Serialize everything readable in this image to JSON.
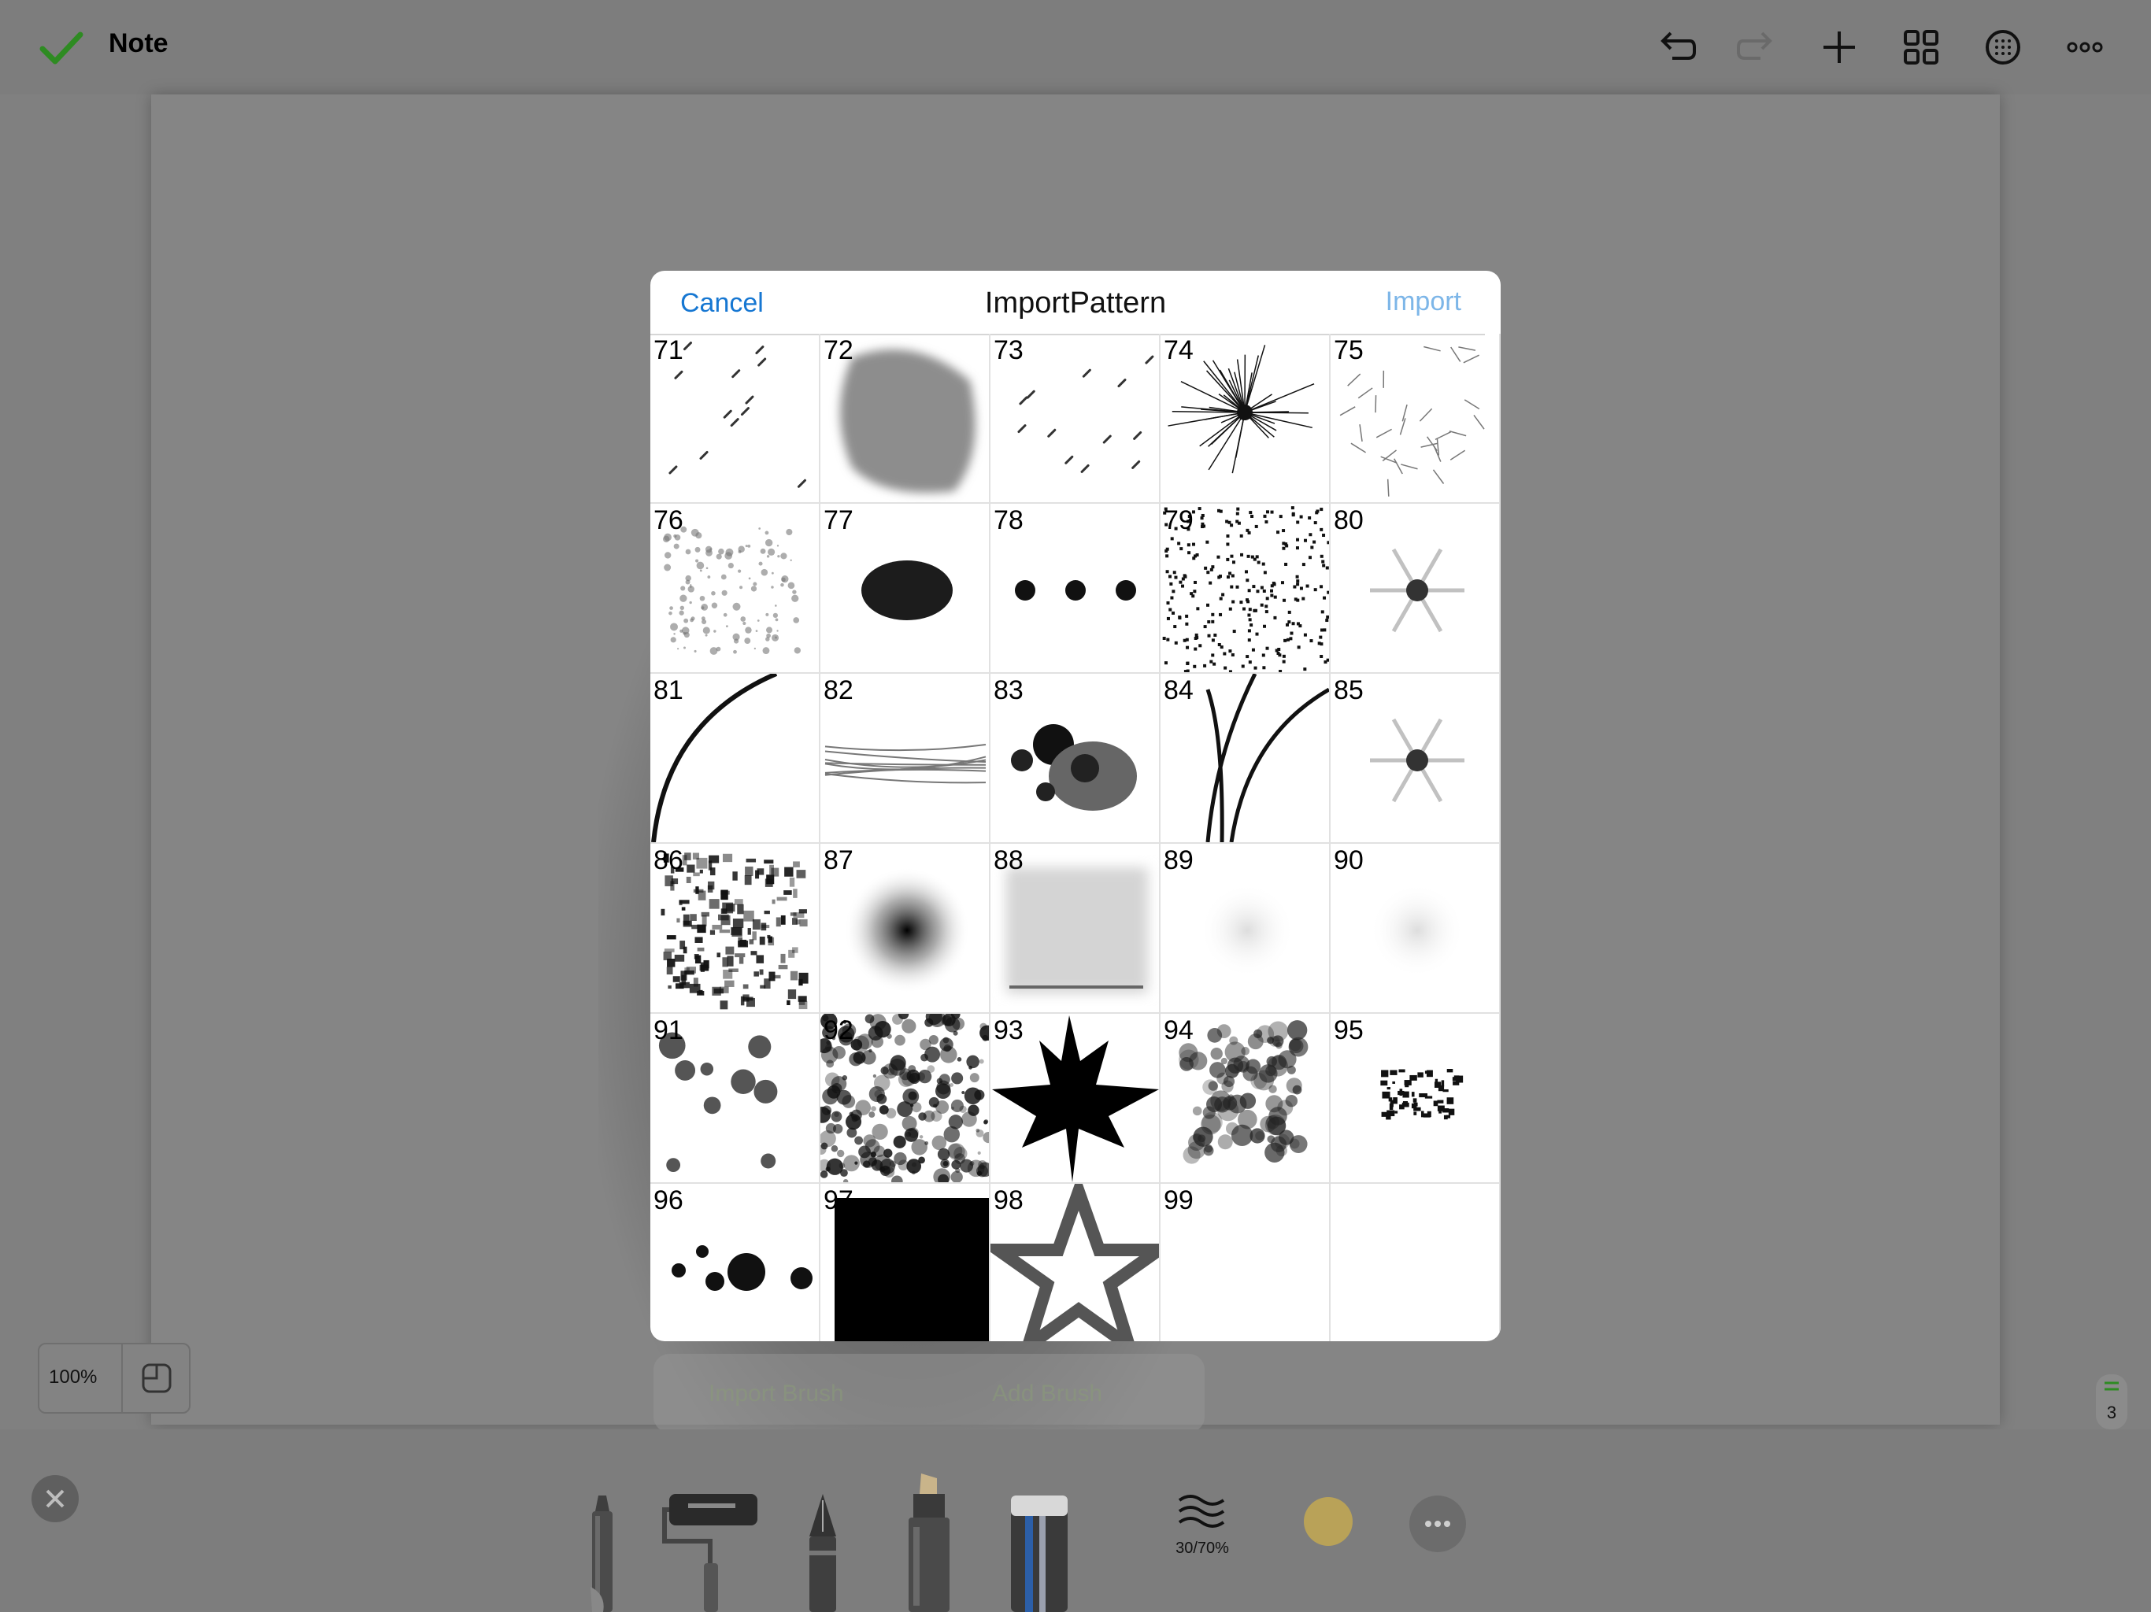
{
  "topbar": {
    "title": "Note",
    "icons": [
      "checkmark-icon",
      "undo-icon",
      "redo-icon",
      "plus-icon",
      "grid-icon",
      "texture-icon",
      "more-icon"
    ]
  },
  "zoom": {
    "value": "100%"
  },
  "page_indicator": {
    "number": "3"
  },
  "bottom": {
    "brush_setting": "30/70%",
    "color": "#b9a258",
    "tools": [
      "marker",
      "paint-roller",
      "fountain-pen",
      "highlighter",
      "eraser"
    ],
    "menu_ghost_left": "Import Brush",
    "menu_ghost_right": "Add Brush"
  },
  "modal": {
    "title": "ImportPattern",
    "cancel_label": "Cancel",
    "import_label": "Import",
    "patterns": [
      {
        "num": "71",
        "kind": "streaks"
      },
      {
        "num": "72",
        "kind": "blot"
      },
      {
        "num": "73",
        "kind": "streaks"
      },
      {
        "num": "74",
        "kind": "starburst"
      },
      {
        "num": "75",
        "kind": "scratches"
      },
      {
        "num": "76",
        "kind": "cloud"
      },
      {
        "num": "77",
        "kind": "blob"
      },
      {
        "num": "78",
        "kind": "three-dots"
      },
      {
        "num": "79",
        "kind": "speckle"
      },
      {
        "num": "80",
        "kind": "snowflake"
      },
      {
        "num": "81",
        "kind": "arc"
      },
      {
        "num": "82",
        "kind": "strands"
      },
      {
        "num": "83",
        "kind": "ink-splat"
      },
      {
        "num": "84",
        "kind": "grass"
      },
      {
        "num": "85",
        "kind": "snowflake"
      },
      {
        "num": "86",
        "kind": "noise"
      },
      {
        "num": "87",
        "kind": "radial"
      },
      {
        "num": "88",
        "kind": "soft-square"
      },
      {
        "num": "89",
        "kind": "faint"
      },
      {
        "num": "90",
        "kind": "faint"
      },
      {
        "num": "91",
        "kind": "flowers"
      },
      {
        "num": "92",
        "kind": "rock"
      },
      {
        "num": "93",
        "kind": "leaf"
      },
      {
        "num": "94",
        "kind": "sponge"
      },
      {
        "num": "95",
        "kind": "smear"
      },
      {
        "num": "96",
        "kind": "dots"
      },
      {
        "num": "97",
        "kind": "square"
      },
      {
        "num": "98",
        "kind": "star"
      },
      {
        "num": "99",
        "kind": "empty"
      },
      {
        "num": "",
        "kind": "empty"
      }
    ]
  }
}
